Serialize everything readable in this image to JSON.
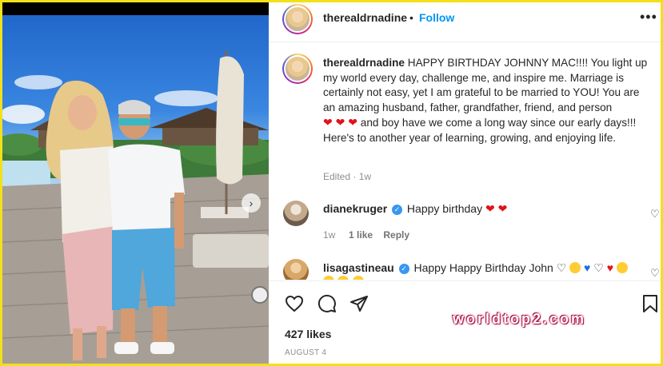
{
  "post": {
    "author": "therealdrnadine",
    "follow_label": "Follow",
    "separator": "•",
    "more_label": "•••",
    "caption_text": "HAPPY BIRTHDAY JOHNNY MAC!!!! You light up my world every day, challenge me, and inspire me. Marriage is certainly not easy, yet I am grateful to be married to YOU! You are an amazing husband, father, grandfather, friend, and person",
    "caption_hearts": "❤ ❤ ❤",
    "caption_tail": " and boy have we come a long way since our early days!!! Here's to another year of learning, growing, and enjoying life.",
    "edited_label": "Edited · 1w",
    "likes": "427 likes",
    "date": "AUGUST 4"
  },
  "comments": [
    {
      "user": "dianekruger",
      "verified": true,
      "text": "Happy birthday",
      "emojis": "❤ ❤",
      "age": "1w",
      "likes": "1 like",
      "reply": "Reply"
    },
    {
      "user": "lisagastineau",
      "verified": true,
      "text": "Happy Happy Birthday John"
    }
  ],
  "icons": {
    "like": "heart-outline-icon",
    "comment": "comment-bubble-icon",
    "share": "paper-plane-icon",
    "save": "bookmark-icon",
    "more": "more-options-icon",
    "carousel": "chevron-right-icon"
  },
  "watermark": "worldtop2.com",
  "colors": {
    "follow": "#0095f6",
    "frame": "#f2e01a",
    "heart": "#e0131a",
    "verified": "#3897f0",
    "watermark": "#c0134f"
  }
}
